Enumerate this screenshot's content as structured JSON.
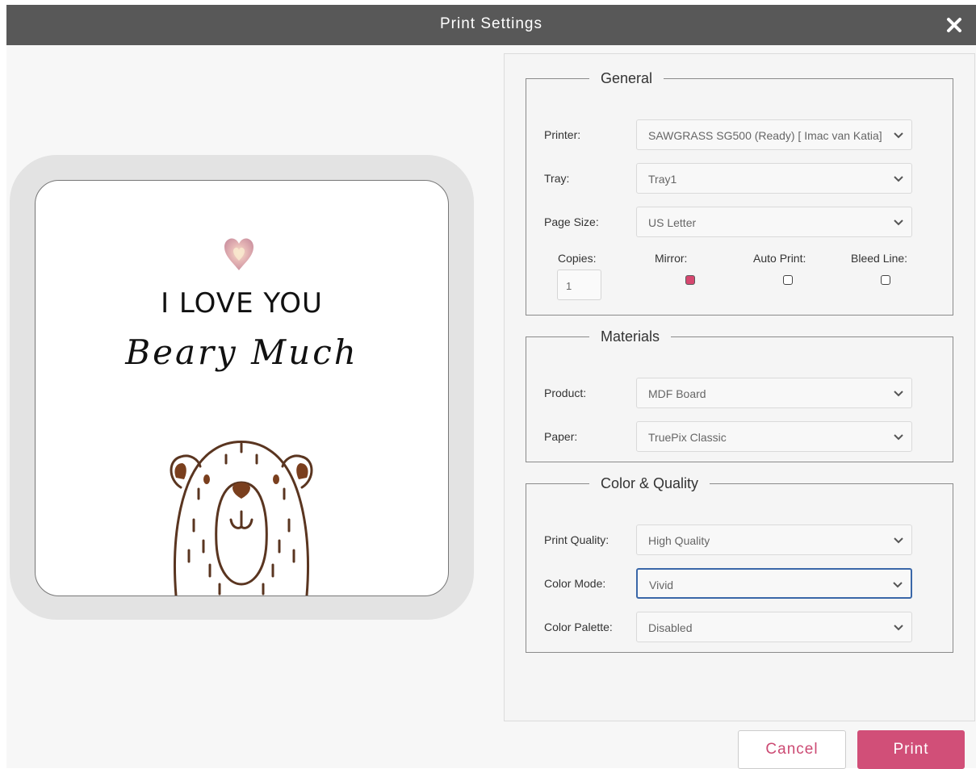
{
  "window": {
    "title": "Print Settings",
    "close_icon": "close-icon"
  },
  "preview": {
    "heart_icon": "heart-icon",
    "line1": "I LOVE YOU",
    "line2": "Beary Much",
    "illustration": "bear-illustration"
  },
  "general": {
    "legend": "General",
    "printer": {
      "label": "Printer:",
      "value": "SAWGRASS SG500 (Ready) [ Imac van Katia]"
    },
    "tray": {
      "label": "Tray:",
      "value": "Tray1"
    },
    "page_size": {
      "label": "Page Size:",
      "value": "US Letter"
    },
    "copies": {
      "label": "Copies:",
      "value": "1"
    },
    "mirror": {
      "label": "Mirror:",
      "checked": true
    },
    "auto_print": {
      "label": "Auto Print:",
      "checked": false
    },
    "bleed_line": {
      "label": "Bleed Line:",
      "checked": false
    }
  },
  "materials": {
    "legend": "Materials",
    "product": {
      "label": "Product:",
      "value": "MDF Board"
    },
    "paper": {
      "label": "Paper:",
      "value": "TruePix Classic"
    }
  },
  "color_quality": {
    "legend": "Color & Quality",
    "print_quality": {
      "label": "Print Quality:",
      "value": "High Quality"
    },
    "color_mode": {
      "label": "Color Mode:",
      "value": "Vivid"
    },
    "color_palette": {
      "label": "Color Palette:",
      "value": "Disabled"
    }
  },
  "buttons": {
    "cancel": "Cancel",
    "print": "Print"
  },
  "colors": {
    "titlebar": "#585858",
    "accent": "#d14f78",
    "focus_border": "#3a67a8",
    "checkbox_on": "#d6476f",
    "panel_bg": "#f5f5f5"
  }
}
